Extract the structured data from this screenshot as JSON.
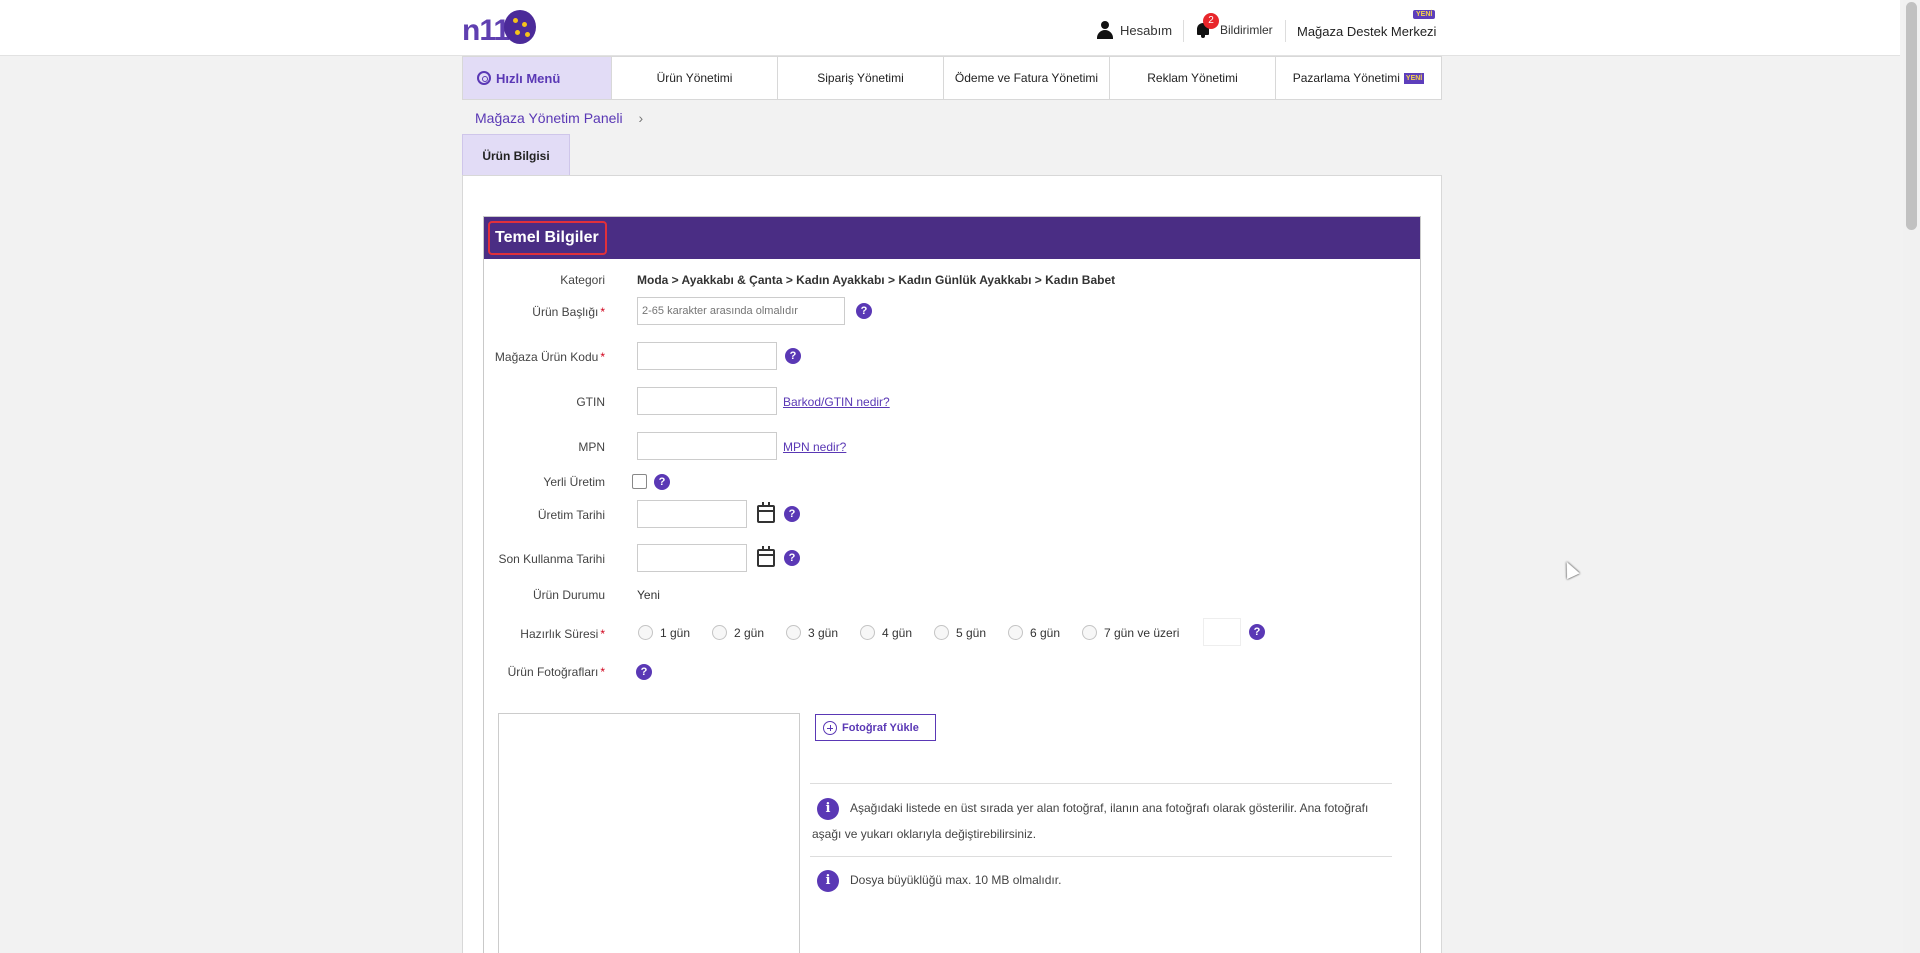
{
  "header": {
    "logo_text": "n11",
    "account_label": "Hesabım",
    "notifications_label": "Bildirimler",
    "notifications_count": "2",
    "support_label": "Mağaza Destek Merkezi",
    "new_tag": "YENİ"
  },
  "nav": {
    "quick_menu": "Hızlı Menü",
    "items": [
      "Ürün Yönetimi",
      "Sipariş Yönetimi",
      "Ödeme ve Fatura Yönetimi",
      "Reklam Yönetimi",
      "Pazarlama Yönetimi"
    ],
    "new_tag": "YENİ"
  },
  "breadcrumb": {
    "root": "Mağaza Yönetim Paneli",
    "separator": "›"
  },
  "tab": {
    "label": "Ürün Bilgisi"
  },
  "section": {
    "title": "Temel Bilgiler"
  },
  "form": {
    "category_label": "Kategori",
    "category_value": "Moda > Ayakkabı & Çanta > Kadın Ayakkabı > Kadın Günlük Ayakkabı > Kadın Babet",
    "title_label": "Ürün Başlığı",
    "title_placeholder": "2-65 karakter arasında olmalıdır",
    "store_code_label": "Mağaza Ürün Kodu",
    "gtin_label": "GTIN",
    "gtin_link": "Barkod/GTIN nedir?",
    "mpn_label": "MPN",
    "mpn_link": "MPN nedir?",
    "local_label": "Yerli Üretim",
    "production_date_label": "Üretim Tarihi",
    "expiry_date_label": "Son Kullanma Tarihi",
    "condition_label": "Ürün Durumu",
    "condition_value": "Yeni",
    "prep_label": "Hazırlık Süresi",
    "prep_options": [
      "1 gün",
      "2 gün",
      "3 gün",
      "4 gün",
      "5 gün",
      "6 gün",
      "7 gün ve üzeri"
    ],
    "photos_label": "Ürün Fotoğrafları",
    "required_mark": "*",
    "help_mark": "?"
  },
  "photos": {
    "upload_button": "Fotoğraf Yükle",
    "info_1": "Aşağıdaki listede en üst sırada yer alan fotoğraf, ilanın ana fotoğrafı olarak gösterilir. Ana fotoğrafı aşağı ve yukarı oklarıyla değiştirebilirsiniz.",
    "info_2": "Dosya büyüklüğü max. 10 MB olmalıdır.",
    "info_icon": "i"
  },
  "colors": {
    "brand": "#5a38b5",
    "header_bar": "#4a2d84",
    "highlight": "#e0303b"
  }
}
